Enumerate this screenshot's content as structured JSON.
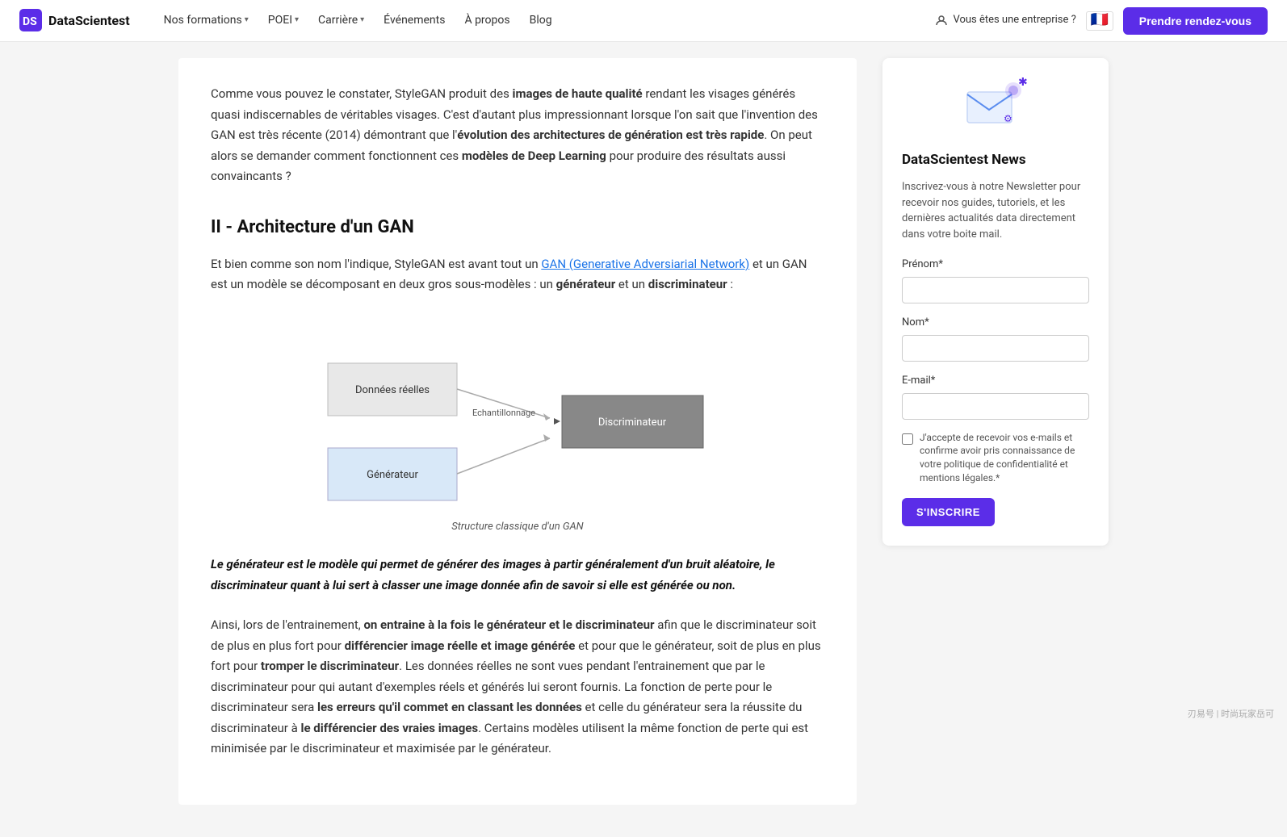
{
  "navbar": {
    "logo_text": "DataScientest",
    "nos_formations_label": "Nos formations",
    "poei_label": "POEI",
    "carriere_label": "Carrière",
    "evenements_label": "Événements",
    "a_propos_label": "À propos",
    "blog_label": "Blog",
    "enterprise_label": "Vous êtes une entreprise ?",
    "cta_label": "Prendre rendez-vous"
  },
  "main": {
    "intro_p1_start": "Comme vous pouvez le constater, StyleGAN produit des ",
    "intro_bold1": "images de haute qualité",
    "intro_p1_mid": " rendant les visages générés quasi indiscernables de véritables visages. C'est d'autant plus impressionnant lorsque l'on sait que l'invention des GAN est très récente (2014) démontrant que l'",
    "intro_bold2": "évolution des architectures de génération est très rapide",
    "intro_p1_end": ". On peut alors se demander comment fonctionnent ces ",
    "intro_bold3": "modèles de Deep Learning",
    "intro_p1_last": " pour produire des résultats aussi convaincants ?",
    "section2_title": "II - Architecture d'un GAN",
    "section2_p1_start": "Et bien comme son nom l'indique, StyleGAN est avant tout un ",
    "section2_link": "GAN (Generative Adversiarial Network)",
    "section2_p1_mid": " et un GAN est un modèle se décomposant en deux gros sous-modèles : un ",
    "section2_bold1": "générateur",
    "section2_p1_and": " et un ",
    "section2_bold2": "discriminateur",
    "section2_p1_end": " :",
    "diagram_caption": "Structure classique d'un GAN",
    "diagram_nodes": {
      "donnees_reelles": "Données réelles",
      "echantillonnage": "Echantillonnage",
      "discriminateur": "Discriminateur",
      "generateur": "Générateur"
    },
    "blockquote": "Le générateur est le modèle qui permet de générer des images à partir généralement d'un bruit aléatoire, le discriminateur quant à lui sert à classer une image donnée afin de savoir si elle est générée ou non.",
    "last_para_start": "Ainsi, lors de l'entrainement, ",
    "last_bold1": "on entraine à la fois le générateur et le discriminateur",
    "last_para_mid1": " afin que le discriminateur soit de plus en plus fort pour ",
    "last_bold2": "différencier image réelle et image générée",
    "last_para_mid2": " et pour que le générateur, soit de plus en plus fort pour ",
    "last_bold3": "tromper le discriminateur",
    "last_para_mid3": ". Les données réelles ne sont vues pendant l'entrainement que par le discriminateur pour qui autant d'exemples réels et générés lui seront fournis. La fonction de perte pour le discriminateur sera ",
    "last_bold4": "les erreurs qu'il commet en classant les données",
    "last_para_mid4": " et celle du générateur sera la réussite du discriminateur à ",
    "last_bold5": "le différencier des vraies images",
    "last_para_end": ". Certains modèles utilisent la même fonction de perte qui est minimisée par le discriminateur et maximisée par le générateur."
  },
  "sidebar": {
    "newsletter_title": "DataScientest News",
    "newsletter_desc": "Inscrivez-vous à notre Newsletter pour recevoir nos guides, tutoriels, et les dernières actualités data directement dans votre boite mail.",
    "prenom_label": "Prénom*",
    "nom_label": "Nom*",
    "email_label": "E-mail*",
    "checkbox_label": "J'accepte de recevoir vos e-mails et confirme avoir pris connaissance de votre politique de confidentialité et mentions légales.*",
    "subscribe_btn_label": "S'INSCRIRE"
  },
  "watermark": "刃易号 | 时尚玩家岳可"
}
